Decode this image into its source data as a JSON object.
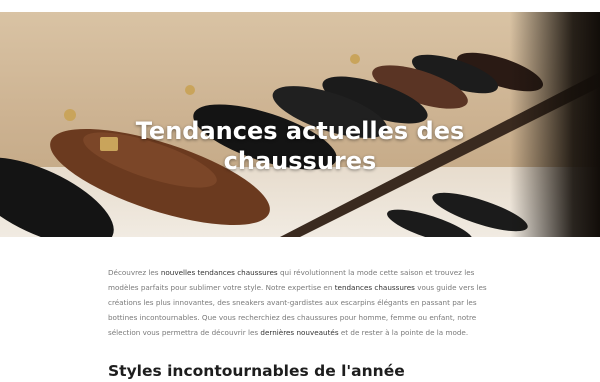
{
  "hero": {
    "title_line1": "Tendances actuelles des",
    "title_line2": "chaussures",
    "image_icon": "shoes-on-shelf-photo"
  },
  "intro": {
    "p1": "Découvrez les ",
    "s1": "nouvelles tendances chaussures",
    "p2": " qui révolutionnent la mode cette saison et trouvez les modèles parfaits pour sublimer votre style. Notre expertise en ",
    "s2": "tendances chaussures",
    "p3": " vous guide vers les créations les plus innovantes, des sneakers avant-gardistes aux escarpins élégants en passant par les bottines incontournables. Que vous recherchiez des chaussures pour homme, femme ou enfant, notre sélection vous permettra de découvrir les ",
    "s3": "dernières nouveautés",
    "p4": " et de rester à la pointe de la mode."
  },
  "section": {
    "title": "Styles incontournables de l'année"
  },
  "colors": {
    "text_muted": "#7a7a7a",
    "text_strong": "#333333",
    "heading": "#1d1d1d",
    "leather_brown": "#6b3a1f",
    "leather_black": "#1a1a1a"
  }
}
